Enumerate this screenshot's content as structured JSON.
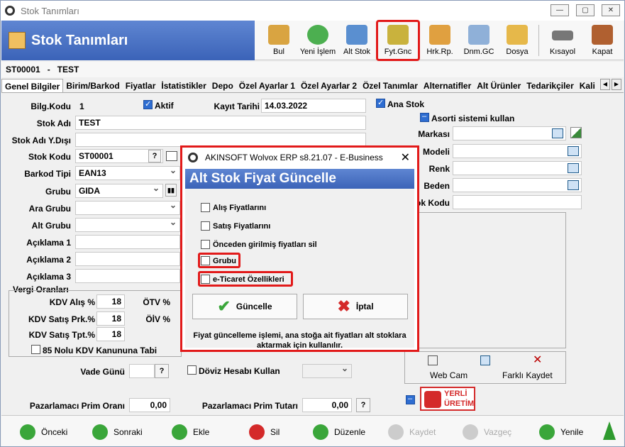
{
  "window": {
    "title": "Stok Tanımları"
  },
  "header": {
    "title": "Stok Tanımları"
  },
  "toolbar": [
    {
      "label": "Bul",
      "icon": "binoculars-icon"
    },
    {
      "label": "Yeni İşlem",
      "icon": "add-icon"
    },
    {
      "label": "Alt Stok",
      "icon": "network-icon"
    },
    {
      "label": "Fyt.Gnc",
      "icon": "coins-icon"
    },
    {
      "label": "Hrk.Rp.",
      "icon": "report-icon"
    },
    {
      "label": "Dnm.GC",
      "icon": "document-icon"
    },
    {
      "label": "Dosya",
      "icon": "folder-icon"
    },
    {
      "label": "Kısayol",
      "icon": "keyboard-icon"
    },
    {
      "label": "Kapat",
      "icon": "exit-icon"
    }
  ],
  "codebar": {
    "code": "ST00001",
    "sep": "-",
    "name": "TEST"
  },
  "tabs": [
    "Genel Bilgiler",
    "Birim/Barkod",
    "Fiyatlar",
    "İstatistikler",
    "Depo",
    "Özel Ayarlar 1",
    "Özel Ayarlar 2",
    "Özel Tanımlar",
    "Alternatifler",
    "Alt Ürünler",
    "Tedarikçiler",
    "Kali"
  ],
  "form": {
    "bilg_kodu_label": "Bilg.Kodu",
    "bilg_kodu_value": "1",
    "aktif_label": "Aktif",
    "kayit_tarihi_label": "Kayıt Tarihi",
    "kayit_tarihi_value": "14.03.2022",
    "stok_adi_label": "Stok Adı",
    "stok_adi_value": "TEST",
    "stok_adi_yd_label": "Stok Adı Y.Dışı",
    "stok_kodu_label": "Stok Kodu",
    "stok_kodu_value": "ST00001",
    "barkod_tipi_label": "Barkod Tipi",
    "barkod_tipi_value": "EAN13",
    "grubu_label": "Grubu",
    "grubu_value": "GIDA",
    "ara_grubu_label": "Ara Grubu",
    "alt_grubu_label": "Alt Grubu",
    "aciklama1_label": "Açıklama 1",
    "aciklama2_label": "Açıklama 2",
    "aciklama3_label": "Açıklama 3",
    "vergi_title": "Vergi Oranları",
    "kdv_alis_label": "KDV Alış %",
    "kdv_alis_value": "18",
    "kdv_satis_prk_label": "KDV Satış Prk.%",
    "kdv_satis_prk_value": "18",
    "kdv_satis_tpt_label": "KDV Satış Tpt.%",
    "kdv_satis_tpt_value": "18",
    "otv_label": "ÖTV %",
    "oiv_label": "ÖİV %",
    "kanun_label": "85 Nolu KDV Kanununa Tabi",
    "vade_label": "Vade Günü",
    "doviz_label": "Döviz Hesabı Kullan",
    "prim_orani_label": "Pazarlamacı Prim Oranı",
    "prim_orani_value": "0,00",
    "prim_tutari_label": "Pazarlamacı Prim Tutarı",
    "prim_tutari_value": "0,00",
    "question": "?"
  },
  "right": {
    "ana_stok_label": "Ana Stok",
    "asorti_label": "Asorti sistemi kullan",
    "markasi_label": "Markası",
    "modeli_label": "Modeli",
    "renk_label": "Renk",
    "beden_label": "Beden",
    "ok_kodu_label": "ok Kodu",
    "webcam_label": "Web Cam",
    "farkli_kaydet_label": "Farklı Kaydet",
    "yerli_top": "YERLİ",
    "yerli_bottom": "ÜRETİM"
  },
  "footer": [
    {
      "label": "Önceki",
      "color": "#3aa63a",
      "enabled": true
    },
    {
      "label": "Sonraki",
      "color": "#3aa63a",
      "enabled": true
    },
    {
      "label": "Ekle",
      "color": "#3aa63a",
      "enabled": true
    },
    {
      "label": "Sil",
      "color": "#d42a2a",
      "enabled": true
    },
    {
      "label": "Düzenle",
      "color": "#3aa63a",
      "enabled": true
    },
    {
      "label": "Kaydet",
      "color": "#bbbbbb",
      "enabled": false
    },
    {
      "label": "Vazgeç",
      "color": "#bbbbbb",
      "enabled": false
    },
    {
      "label": "Yenile",
      "color": "#3aa63a",
      "enabled": true
    }
  ],
  "dialog": {
    "title": "AKINSOFT Wolvox ERP s8.21.07 - E-Business",
    "banner": "Alt Stok Fiyat Güncelle",
    "options": [
      "Alış Fiyatlarını",
      "Satış Fiyatlarını",
      "Önceden girilmiş fiyatları sil",
      "Grubu",
      "e-Ticaret Özellikleri"
    ],
    "update_label": "Güncelle",
    "cancel_label": "İptal",
    "note": "Fiyat güncelleme işlemi, ana stoğa ait fiyatları alt stoklara aktarmak için kullanılır."
  },
  "colors": {
    "accent": "#3b63b8",
    "highlight": "#e21a1a"
  }
}
